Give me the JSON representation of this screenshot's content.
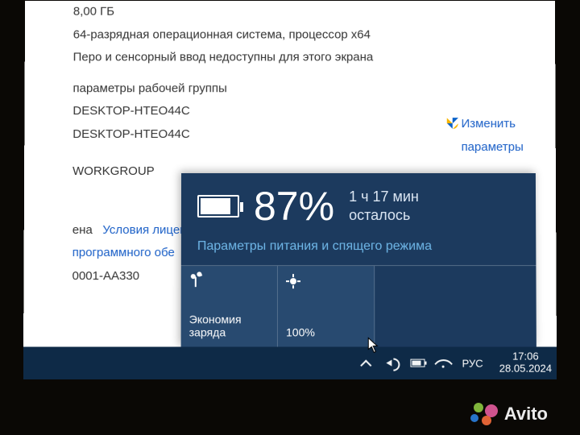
{
  "sysprops": {
    "ram_tail": "8,00 ГБ",
    "arch": "64-разрядная операционная система, процессор x64",
    "pen_touch": "Перо и сенсорный ввод недоступны для этого экрана",
    "workgroup_params_tail": "параметры рабочей группы",
    "computer_name_1": "DESKTOP-HTEO44C",
    "computer_name_2": "DESKTOP-HTEO44C",
    "workgroup_value": "WORKGROUP",
    "activation_status_tail": "ена",
    "license_link_line1": "Условия лицензион",
    "license_link_line2": "программного обе",
    "product_id_tail": "0001-AA330",
    "change_link_line1": "Изменить",
    "change_link_line2": "параметры"
  },
  "battery": {
    "percent": "87%",
    "remaining_time": "1 ч 17 мин",
    "remaining_label": "осталось",
    "settings_link": "Параметры питания и спящего режима",
    "tile_saver_line1": "Экономия",
    "tile_saver_line2": "заряда",
    "tile_brightness_value": "100%"
  },
  "taskbar": {
    "lang": "РУС",
    "time": "17:06",
    "date": "28.05.2024"
  },
  "watermark": "Avito"
}
